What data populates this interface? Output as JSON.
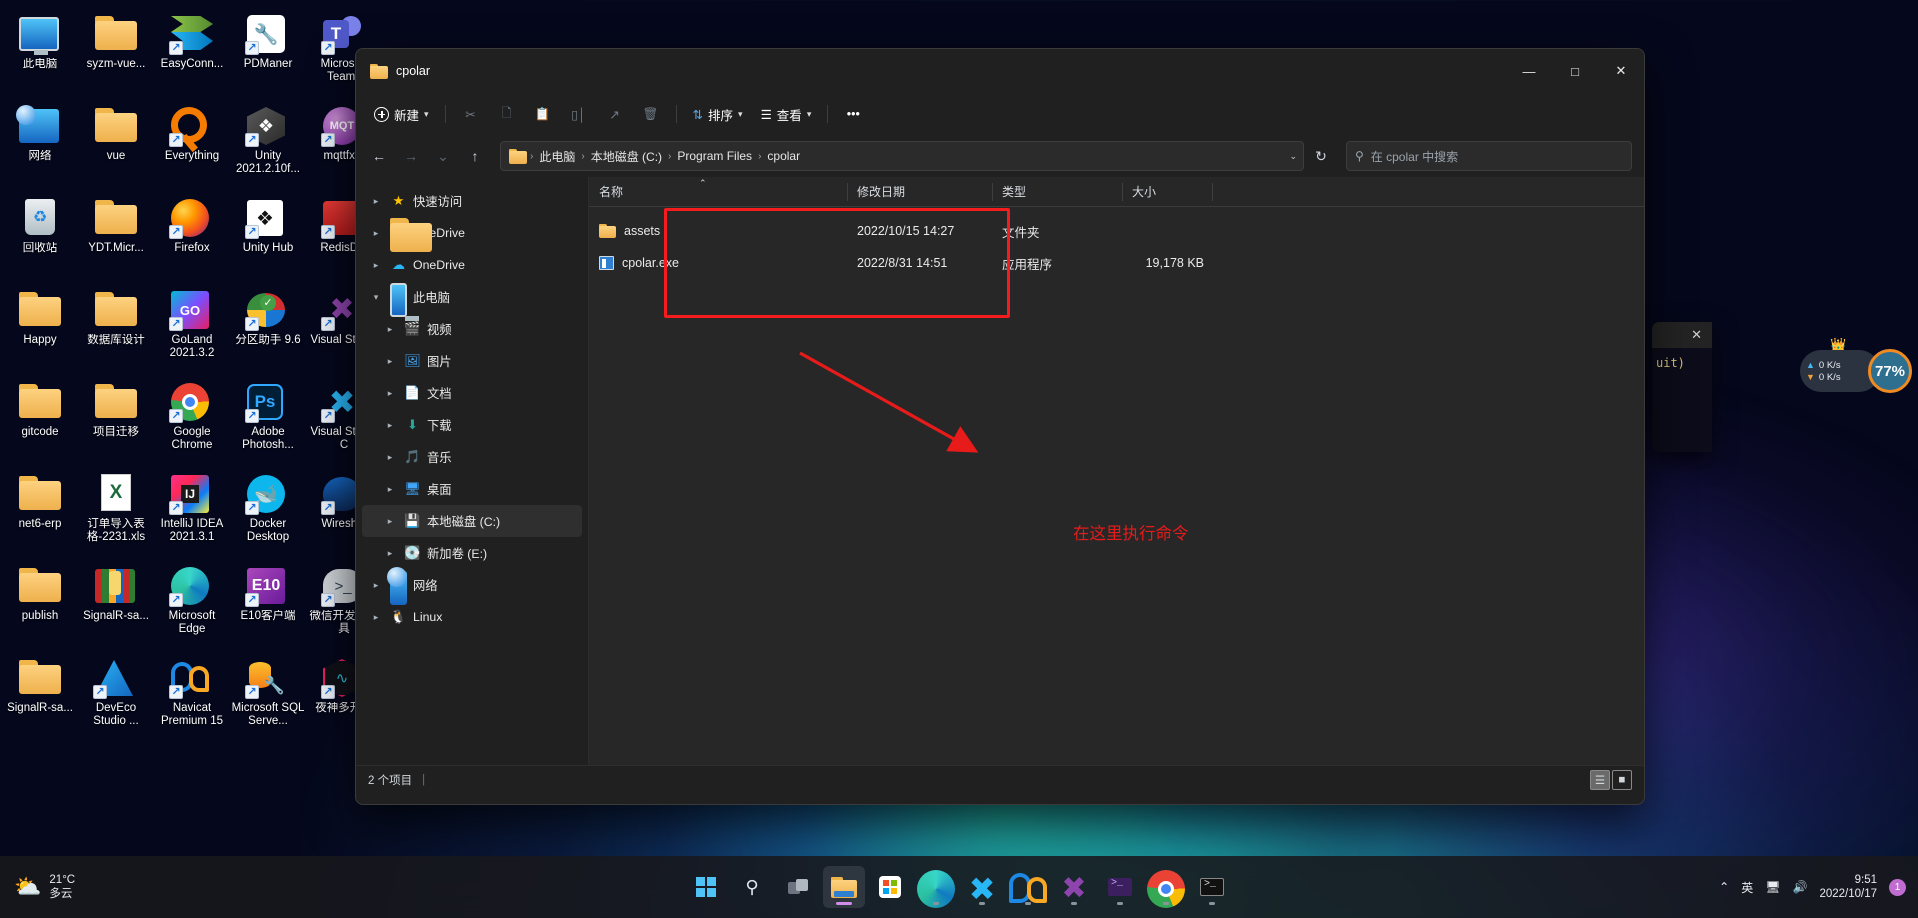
{
  "desktop": {
    "icons": [
      {
        "label": "此电脑",
        "icon": "this-pc-icon",
        "shortcut": false
      },
      {
        "label": "syzm-vue...",
        "icon": "folder-icon",
        "shortcut": false
      },
      {
        "label": "EasyConn...",
        "icon": "easyconnect-icon",
        "shortcut": true
      },
      {
        "label": "PDManer",
        "icon": "pdmaner-icon",
        "shortcut": true
      },
      {
        "label": "Microsoft Teams",
        "icon": "teams-icon",
        "shortcut": true
      },
      {
        "label": "网络",
        "icon": "network-icon",
        "shortcut": false
      },
      {
        "label": "vue",
        "icon": "folder-icon",
        "shortcut": false
      },
      {
        "label": "Everything",
        "icon": "everything-icon",
        "shortcut": true
      },
      {
        "label": "Unity 2021.2.10f...",
        "icon": "unity-icon",
        "shortcut": true
      },
      {
        "label": "mqttfx...",
        "icon": "mqttfx-icon",
        "shortcut": true
      },
      {
        "label": "回收站",
        "icon": "recycle-bin-icon",
        "shortcut": false
      },
      {
        "label": "YDT.Micr...",
        "icon": "folder-icon",
        "shortcut": false
      },
      {
        "label": "Firefox",
        "icon": "firefox-icon",
        "shortcut": true
      },
      {
        "label": "Unity Hub",
        "icon": "unity-hub-icon",
        "shortcut": true
      },
      {
        "label": "RedisD...",
        "icon": "redis-icon",
        "shortcut": true
      },
      {
        "label": "Happy",
        "icon": "folder-icon",
        "shortcut": false
      },
      {
        "label": "数据库设计",
        "icon": "folder-icon",
        "shortcut": false
      },
      {
        "label": "GoLand 2021.3.2",
        "icon": "goland-icon",
        "shortcut": true
      },
      {
        "label": "分区助手 9.6",
        "icon": "partition-assistant-icon",
        "shortcut": true
      },
      {
        "label": "Visual Studio",
        "icon": "visual-studio-icon",
        "shortcut": true
      },
      {
        "label": "gitcode",
        "icon": "folder-icon",
        "shortcut": false
      },
      {
        "label": "项目迁移",
        "icon": "folder-icon",
        "shortcut": false
      },
      {
        "label": "Google Chrome",
        "icon": "chrome-icon",
        "shortcut": true
      },
      {
        "label": "Adobe Photosh...",
        "icon": "photoshop-icon",
        "shortcut": true
      },
      {
        "label": "Visual Studio C",
        "icon": "vscode-icon",
        "shortcut": true
      },
      {
        "label": "net6-erp",
        "icon": "folder-icon",
        "shortcut": false
      },
      {
        "label": "订单导入表格-2231.xls",
        "icon": "excel-file-icon",
        "shortcut": false
      },
      {
        "label": "IntelliJ IDEA 2021.3.1",
        "icon": "intellij-icon",
        "shortcut": true
      },
      {
        "label": "Docker Desktop",
        "icon": "docker-icon",
        "shortcut": true
      },
      {
        "label": "Wiresh...",
        "icon": "wireshark-icon",
        "shortcut": true
      },
      {
        "label": "publish",
        "icon": "folder-icon",
        "shortcut": false
      },
      {
        "label": "SignalR-sa...",
        "icon": "winrar-archive-icon",
        "shortcut": false
      },
      {
        "label": "Microsoft Edge",
        "icon": "edge-icon",
        "shortcut": true
      },
      {
        "label": "E10客户端",
        "icon": "e10-client-icon",
        "shortcut": true
      },
      {
        "label": "微信开发者工具",
        "icon": "wechat-devtools-icon",
        "shortcut": true
      },
      {
        "label": "SignalR-sa...",
        "icon": "folder-icon",
        "shortcut": false
      },
      {
        "label": "DevEco Studio ...",
        "icon": "deveco-studio-icon",
        "shortcut": true
      },
      {
        "label": "Navicat Premium 15",
        "icon": "navicat-icon",
        "shortcut": true
      },
      {
        "label": "Microsoft SQL Serve...",
        "icon": "sql-server-icon",
        "shortcut": true
      },
      {
        "label": "夜神多开器",
        "icon": "nox-icon",
        "shortcut": true
      }
    ]
  },
  "explorer": {
    "title": "cpolar",
    "window_buttons": {
      "minimize": "—",
      "maximize": "□",
      "close": "✕"
    },
    "toolbar": {
      "new_label": "新建",
      "cut_label": "剪切",
      "copy_label": "复制",
      "paste_label": "粘贴",
      "rename_label": "重命名",
      "share_label": "共享",
      "delete_label": "删除",
      "sort_label": "排序",
      "view_label": "查看",
      "more_label": "•••"
    },
    "nav_buttons": {
      "back": "←",
      "forward": "→",
      "recent": "⌄",
      "up": "↑",
      "refresh": "↻"
    },
    "address": {
      "crumbs": [
        "此电脑",
        "本地磁盘 (C:)",
        "Program Files",
        "cpolar"
      ],
      "separator": "›",
      "dropdown": "⌄"
    },
    "search": {
      "placeholder": "在 cpolar 中搜索",
      "icon": "search-icon"
    },
    "sidebar": {
      "items": [
        {
          "label": "快速访问",
          "icon": "star-icon",
          "level": 1,
          "expanded": false,
          "selected": false
        },
        {
          "label": "OneDrive",
          "icon": "folder-icon",
          "level": 1,
          "expanded": false,
          "selected": false
        },
        {
          "label": "OneDrive",
          "icon": "onedrive-cloud-icon",
          "level": 1,
          "expanded": false,
          "selected": false
        },
        {
          "label": "此电脑",
          "icon": "this-pc-icon",
          "level": 1,
          "expanded": true,
          "selected": false
        },
        {
          "label": "视频",
          "icon": "videos-icon",
          "level": 2,
          "expanded": false,
          "selected": false
        },
        {
          "label": "图片",
          "icon": "pictures-icon",
          "level": 2,
          "expanded": false,
          "selected": false
        },
        {
          "label": "文档",
          "icon": "documents-icon",
          "level": 2,
          "expanded": false,
          "selected": false
        },
        {
          "label": "下载",
          "icon": "downloads-icon",
          "level": 2,
          "expanded": false,
          "selected": false
        },
        {
          "label": "音乐",
          "icon": "music-icon",
          "level": 2,
          "expanded": false,
          "selected": false
        },
        {
          "label": "桌面",
          "icon": "desktop-icon",
          "level": 2,
          "expanded": false,
          "selected": false
        },
        {
          "label": "本地磁盘 (C:)",
          "icon": "local-disk-icon",
          "level": 2,
          "expanded": false,
          "selected": true
        },
        {
          "label": "新加卷 (E:)",
          "icon": "drive-icon",
          "level": 2,
          "expanded": false,
          "selected": false
        },
        {
          "label": "网络",
          "icon": "network-icon",
          "level": 1,
          "expanded": false,
          "selected": false
        },
        {
          "label": "Linux",
          "icon": "linux-icon",
          "level": 1,
          "expanded": false,
          "selected": false
        }
      ]
    },
    "file_list": {
      "columns": [
        "名称",
        "修改日期",
        "类型",
        "大小"
      ],
      "sort_indicator": "⌃",
      "rows": [
        {
          "name": "assets",
          "icon": "folder-icon",
          "date": "2022/10/15 14:27",
          "type": "文件夹",
          "size": ""
        },
        {
          "name": "cpolar.exe",
          "icon": "application-icon",
          "date": "2022/8/31 14:51",
          "type": "应用程序",
          "size": "19,178 KB"
        }
      ]
    },
    "statusbar": {
      "count": "2 个项目",
      "separator": "|"
    },
    "view_toggle": {
      "list_icon": "list-view-icon",
      "details_icon": "details-view-icon"
    }
  },
  "annotations": {
    "box_color": "#f41c1c",
    "text_color": "#e81b1b",
    "note": "在这里执行命令",
    "arrow": "annotation-arrow"
  },
  "terminal_peek": {
    "text": "uit)",
    "close": "✕"
  },
  "net_widget": {
    "upload": "0 K/s",
    "download": "0 K/s",
    "percent": "77%",
    "crown": "VIP"
  },
  "taskbar": {
    "weather": {
      "temp": "21°C",
      "condition": "多云",
      "icon": "partly-cloudy-icon"
    },
    "items": [
      {
        "name": "start-button",
        "icon": "windows-logo-icon",
        "active": false,
        "running": false
      },
      {
        "name": "search-button",
        "icon": "search-icon",
        "active": false,
        "running": false
      },
      {
        "name": "task-view-button",
        "icon": "task-view-icon",
        "active": false,
        "running": false
      },
      {
        "name": "file-explorer",
        "icon": "file-explorer-icon",
        "active": true,
        "running": true
      },
      {
        "name": "microsoft-store",
        "icon": "store-icon",
        "active": false,
        "running": false
      },
      {
        "name": "microsoft-edge",
        "icon": "edge-icon",
        "active": false,
        "running": true
      },
      {
        "name": "vs-code",
        "icon": "vscode-icon",
        "active": false,
        "running": true
      },
      {
        "name": "navicat",
        "icon": "navicat-icon",
        "active": false,
        "running": true
      },
      {
        "name": "visual-studio",
        "icon": "visual-studio-icon",
        "active": false,
        "running": true
      },
      {
        "name": "terminal",
        "icon": "terminal-icon",
        "active": false,
        "running": true
      },
      {
        "name": "google-chrome",
        "icon": "chrome-icon",
        "active": false,
        "running": true
      },
      {
        "name": "command-prompt",
        "icon": "cmd-icon",
        "active": false,
        "running": true
      }
    ],
    "tray": {
      "overflow": "⌃",
      "ime": "英",
      "network_icon": "network-tray-icon",
      "volume_icon": "volume-icon",
      "time": "9:51",
      "date": "2022/10/17",
      "notification_count": "1"
    }
  }
}
